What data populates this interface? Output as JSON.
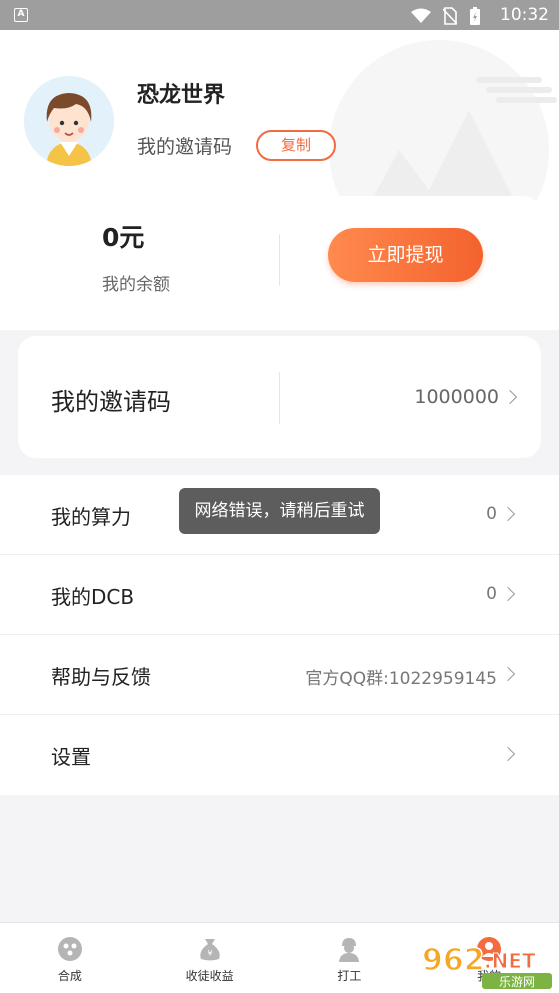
{
  "status_bar": {
    "time": "10:32",
    "app_badge": "A"
  },
  "profile": {
    "username": "恐龙世界",
    "invite_label": "我的邀请码",
    "copy_label": "复制"
  },
  "balance": {
    "amount": "0元",
    "label": "我的余额",
    "withdraw_label": "立即提现"
  },
  "invite_card": {
    "label": "我的邀请码",
    "code": "1000000"
  },
  "menu": [
    {
      "label": "我的算力",
      "value": "0"
    },
    {
      "label": "我的DCB",
      "value": "0"
    },
    {
      "label": "帮助与反馈",
      "value": "官方QQ群:1022959145"
    },
    {
      "label": "设置",
      "value": ""
    }
  ],
  "toast": "网络错误，请稍后重试",
  "bottom_nav": [
    {
      "label": "合成",
      "icon": "synthesis-icon"
    },
    {
      "label": "收徒收益",
      "icon": "money-bag-icon"
    },
    {
      "label": "打工",
      "icon": "worker-icon"
    },
    {
      "label": "我的",
      "icon": "profile-icon"
    }
  ],
  "watermark": {
    "text1": "962",
    "text2": ".NET",
    "text3": "乐游网"
  },
  "colors": {
    "accent": "#f26c40",
    "button_gradient_start": "#ff8a4e",
    "button_gradient_end": "#f4622e",
    "status_bar": "#9e9e9e"
  }
}
